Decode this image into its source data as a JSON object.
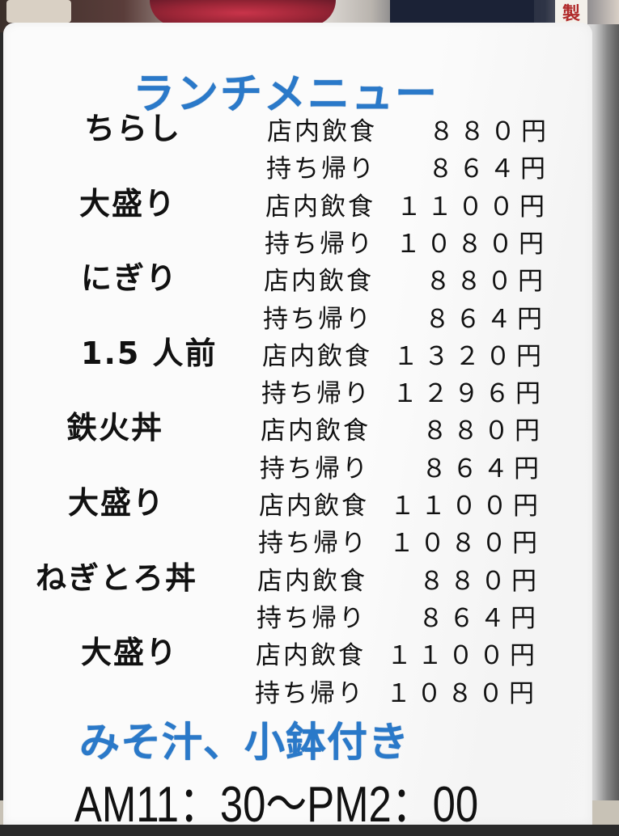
{
  "background": {
    "stamp_char": "製"
  },
  "menu": {
    "title": "ランチメニュー",
    "items": [
      {
        "name": "ちらし",
        "mode": "店内飲食",
        "price": "８８０円"
      },
      {
        "name": "",
        "mode": "持ち帰り",
        "price": "８６４円"
      },
      {
        "name": "大盛り",
        "mode": "店内飲食",
        "price": "１１００円"
      },
      {
        "name": "",
        "mode": "持ち帰り",
        "price": "１０８０円"
      },
      {
        "name": "にぎり",
        "mode": "店内飲食",
        "price": "８８０円"
      },
      {
        "name": "",
        "mode": "持ち帰り",
        "price": "８６４円"
      },
      {
        "name": "1.5 人前",
        "mode": "店内飲食",
        "price": "１３２０円"
      },
      {
        "name": "",
        "mode": "持ち帰り",
        "price": "１２９６円"
      },
      {
        "name": "鉄火丼",
        "mode": "店内飲食",
        "price": "８８０円"
      },
      {
        "name": "",
        "mode": "持ち帰り",
        "price": "８６４円"
      },
      {
        "name": "大盛り",
        "mode": "店内飲食",
        "price": "１１００円"
      },
      {
        "name": "",
        "mode": "持ち帰り",
        "price": "１０８０円"
      },
      {
        "name": "ねぎとろ丼",
        "mode": "店内飲食",
        "price": "８８０円"
      },
      {
        "name": "",
        "mode": "持ち帰り",
        "price": "８６４円"
      },
      {
        "name": "大盛り",
        "mode": "店内飲食",
        "price": "１１００円"
      },
      {
        "name": "",
        "mode": "持ち帰り",
        "price": "１０８０円"
      }
    ],
    "note": "みそ汁、小鉢付き",
    "hours": "AM11：30～PM2：00",
    "colors": {
      "accent": "#2a79c9",
      "text": "#111111",
      "paper": "#fbfbfb"
    }
  }
}
